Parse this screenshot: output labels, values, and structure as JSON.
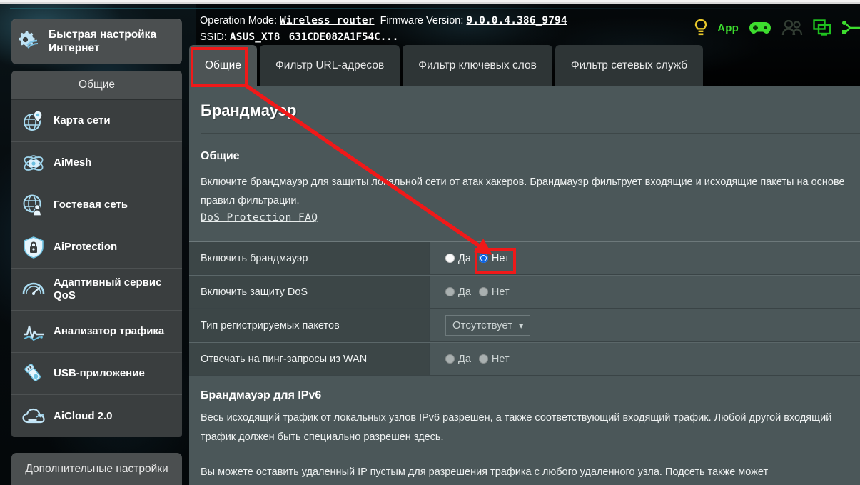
{
  "header": {
    "operation_mode_label": "Operation Mode:",
    "operation_mode_value": "Wireless router",
    "firmware_label": "Firmware Version:",
    "firmware_value": "9.0.0.4.386_9794",
    "ssid_label": "SSID:",
    "ssid_value": "ASUS_XT8",
    "ssid_key": "631CDE082A1F54C...",
    "app_label": "App",
    "icons": [
      {
        "name": "lamp-icon",
        "color": "#e8c72a"
      },
      {
        "name": "app-label",
        "color": "#3ddc2e"
      },
      {
        "name": "gamepad-icon",
        "color": "#3ddc2e"
      },
      {
        "name": "users-icon",
        "color": "#2f3a30"
      },
      {
        "name": "screen-share-icon",
        "color": "#1fc21f"
      },
      {
        "name": "usb-icon",
        "color": "#3ddc2e"
      }
    ]
  },
  "sidebar": {
    "quick_setup": "Быстрая настройка Интернет",
    "group_title": "Общие",
    "items": [
      {
        "label": "Карта сети",
        "icon": "globe-pin-icon"
      },
      {
        "label": "AiMesh",
        "icon": "mesh-atom-icon"
      },
      {
        "label": "Гостевая сеть",
        "icon": "globe-users-icon"
      },
      {
        "label": "AiProtection",
        "icon": "shield-lock-icon"
      },
      {
        "label": "Адаптивный сервис QoS",
        "icon": "gauge-icon"
      },
      {
        "label": "Анализатор трафика",
        "icon": "waveform-icon"
      },
      {
        "label": "USB-приложение",
        "icon": "usb-drive-icon"
      },
      {
        "label": "AiCloud 2.0",
        "icon": "cloud-router-icon"
      }
    ],
    "advanced_button": "Дополнительные настройки"
  },
  "tabs": [
    {
      "label": "Общие",
      "active": true
    },
    {
      "label": "Фильтр URL-адресов",
      "active": false
    },
    {
      "label": "Фильтр ключевых слов",
      "active": false
    },
    {
      "label": "Фильтр сетевых служб",
      "active": false
    }
  ],
  "main": {
    "page_title": "Брандмауэр",
    "section_title": "Общие",
    "description": "Включите брандмауэр для защиты локальной сети от атак хакеров. Брандмауэр фильтрует входящие и исходящие пакеты на основе правил фильтрации.",
    "faq_link": "DoS Protection FAQ",
    "rows": [
      {
        "label": "Включить брандмауэр",
        "type": "radio",
        "options": [
          {
            "label": "Да",
            "selected": false,
            "disabled": false
          },
          {
            "label": "Нет",
            "selected": true,
            "disabled": false
          }
        ]
      },
      {
        "label": "Включить защиту DoS",
        "type": "radio",
        "options": [
          {
            "label": "Да",
            "selected": false,
            "disabled": true
          },
          {
            "label": "Нет",
            "selected": false,
            "disabled": true
          }
        ]
      },
      {
        "label": "Тип регистрируемых пакетов",
        "type": "select",
        "value": "Отсутствует"
      },
      {
        "label": "Отвечать на пинг-запросы из WAN",
        "type": "radio",
        "options": [
          {
            "label": "Да",
            "selected": false,
            "disabled": true
          },
          {
            "label": "Нет",
            "selected": false,
            "disabled": true
          }
        ]
      }
    ],
    "ipv6_section_title": "Брандмауэр для IPv6",
    "ipv6_paragraph_1": "Весь исходящий трафик от локальных узлов IPv6 разрешен, а также соответствующий входящий трафик. Любой другой входящий трафик должен быть специально разрешен здесь.",
    "ipv6_paragraph_2": "Вы можете оставить удаленный IP пустым для разрешения трафика с любого удаленного узла. Подсеть также может"
  },
  "annotation": {
    "color": "#f01919",
    "highlight_tab": "Общие",
    "highlight_radio": "Нет"
  }
}
